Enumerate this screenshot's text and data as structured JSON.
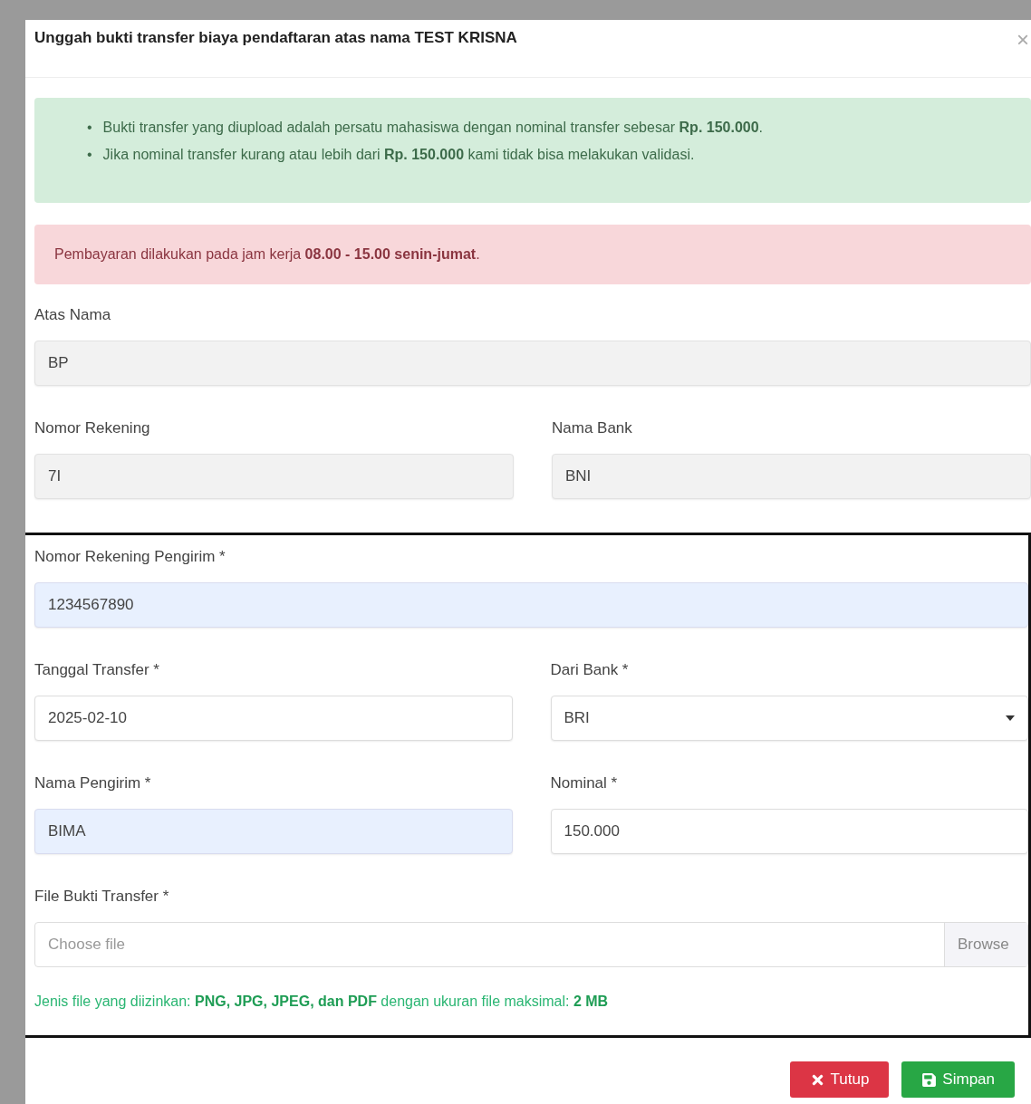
{
  "modal": {
    "title": "Unggah bukti transfer biaya pendaftaran atas nama TEST KRISNA",
    "close": "×"
  },
  "info_alert": {
    "bullet": "•",
    "items": [
      "Bukti transfer yang diupload adalah persatu mahasiswa dengan nominal transfer sebesar **Rp. 150.000**.",
      "Jika nominal transfer kurang atau lebih dari **Rp. 150.000** kami tidak bisa melakukan validasi."
    ]
  },
  "warning_alert": {
    "text": "Pembayaran dilakukan pada jam kerja **08.00 - 15.00 senin-jumat**."
  },
  "account_rows": [
    {
      "fields": [
        {
          "label": "Atas Nama",
          "value": "BP",
          "kind": "readonly"
        }
      ]
    },
    {
      "fields": [
        {
          "label": "Nomor Rekening",
          "value": "7I",
          "kind": "readonly"
        },
        {
          "label": "Nama Bank",
          "value": "BNI",
          "kind": "readonly"
        }
      ]
    }
  ],
  "sender_section": {
    "rows": [
      {
        "fields": [
          {
            "label": "Nomor Rekening Pengirim *",
            "value": "1234567890",
            "kind": "autofilled"
          }
        ]
      },
      {
        "fields": [
          {
            "label": "Tanggal Transfer *",
            "value": "2025-02-10",
            "kind": "text"
          },
          {
            "label": "Dari Bank *",
            "value": "BRI",
            "kind": "select"
          }
        ]
      },
      {
        "fields": [
          {
            "label": "Nama Pengirim *",
            "value": "BIMA",
            "kind": "autofilled"
          },
          {
            "label": "Nominal *",
            "value": "150.000",
            "kind": "text"
          }
        ]
      },
      {
        "fields": [
          {
            "label": "File Bukti Transfer *",
            "placeholder": "Choose file",
            "button": "Browse",
            "kind": "file"
          }
        ]
      }
    ],
    "help_text": "Jenis file yang diizinkan: **PNG, JPG, JPEG, dan PDF** dengan ukuran file maksimal: **2 MB**"
  },
  "buttons": [
    {
      "label": "Tutup",
      "kind": "danger"
    },
    {
      "label": "Simpan",
      "kind": "success"
    }
  ]
}
